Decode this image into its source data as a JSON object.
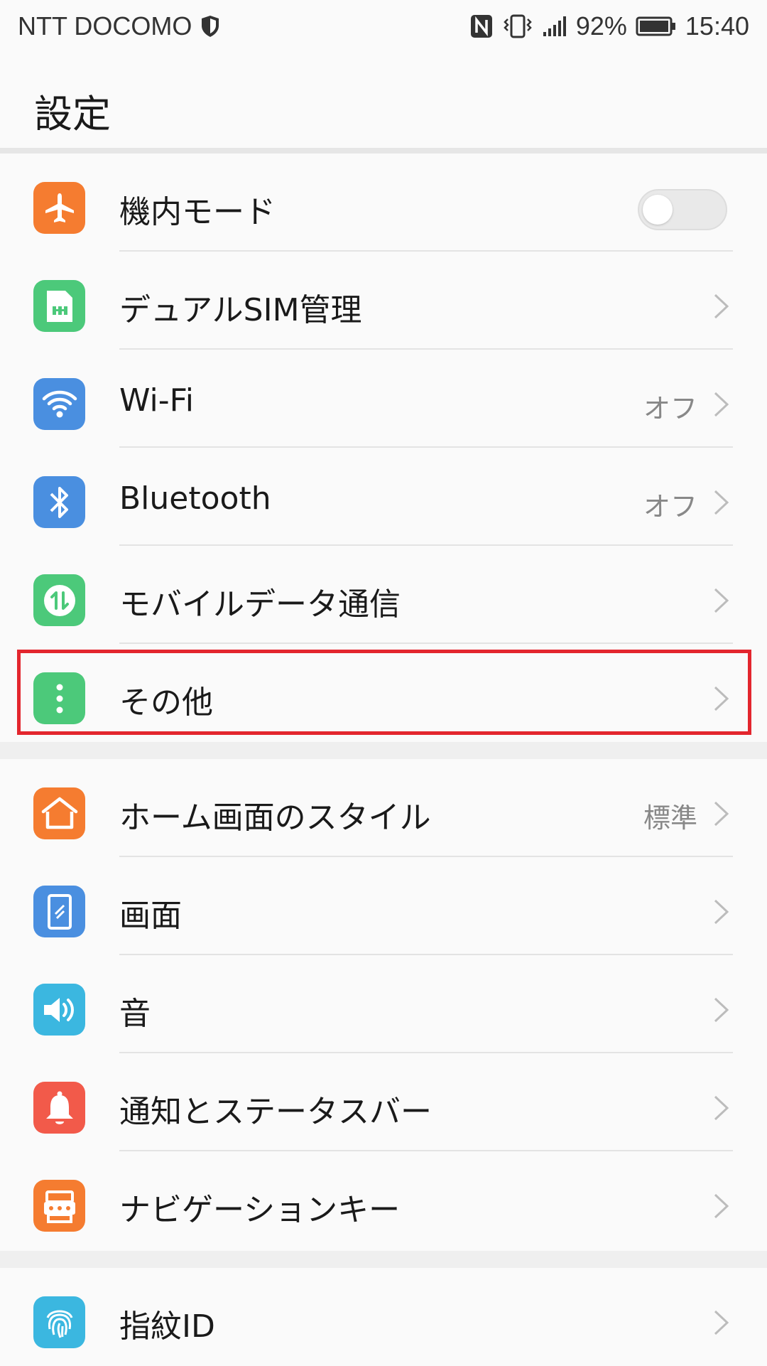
{
  "status_bar": {
    "carrier": "NTT DOCOMO",
    "signal_percent": "92%",
    "time": "15:40"
  },
  "header": {
    "title": "設定"
  },
  "rows": [
    {
      "label": "機内モード",
      "icon": "airplane-icon",
      "color": "#f57c30",
      "toggle": false
    },
    {
      "label": "デュアルSIM管理",
      "icon": "sim-card-icon",
      "color": "#4cc97a"
    },
    {
      "label": "Wi-Fi",
      "value": "オフ",
      "icon": "wifi-icon",
      "color": "#4a8fe0"
    },
    {
      "label": "Bluetooth",
      "value": "オフ",
      "icon": "bluetooth-icon",
      "color": "#4a8fe0"
    },
    {
      "label": "モバイルデータ通信",
      "icon": "mobile-data-icon",
      "color": "#4cc97a"
    },
    {
      "label": "その他",
      "icon": "more-dots-icon",
      "color": "#4cc97a",
      "highlighted": true
    },
    {
      "label": "ホーム画面のスタイル",
      "value": "標準",
      "icon": "home-icon",
      "color": "#f57c30"
    },
    {
      "label": "画面",
      "icon": "display-icon",
      "color": "#4a8fe0"
    },
    {
      "label": "音",
      "icon": "sound-icon",
      "color": "#3bb7e0"
    },
    {
      "label": "通知とステータスバー",
      "icon": "bell-icon",
      "color": "#f25a4a"
    },
    {
      "label": "ナビゲーションキー",
      "icon": "nav-key-icon",
      "color": "#f57c30"
    },
    {
      "label": "指紋ID",
      "icon": "fingerprint-icon",
      "color": "#3bb7e0"
    }
  ]
}
